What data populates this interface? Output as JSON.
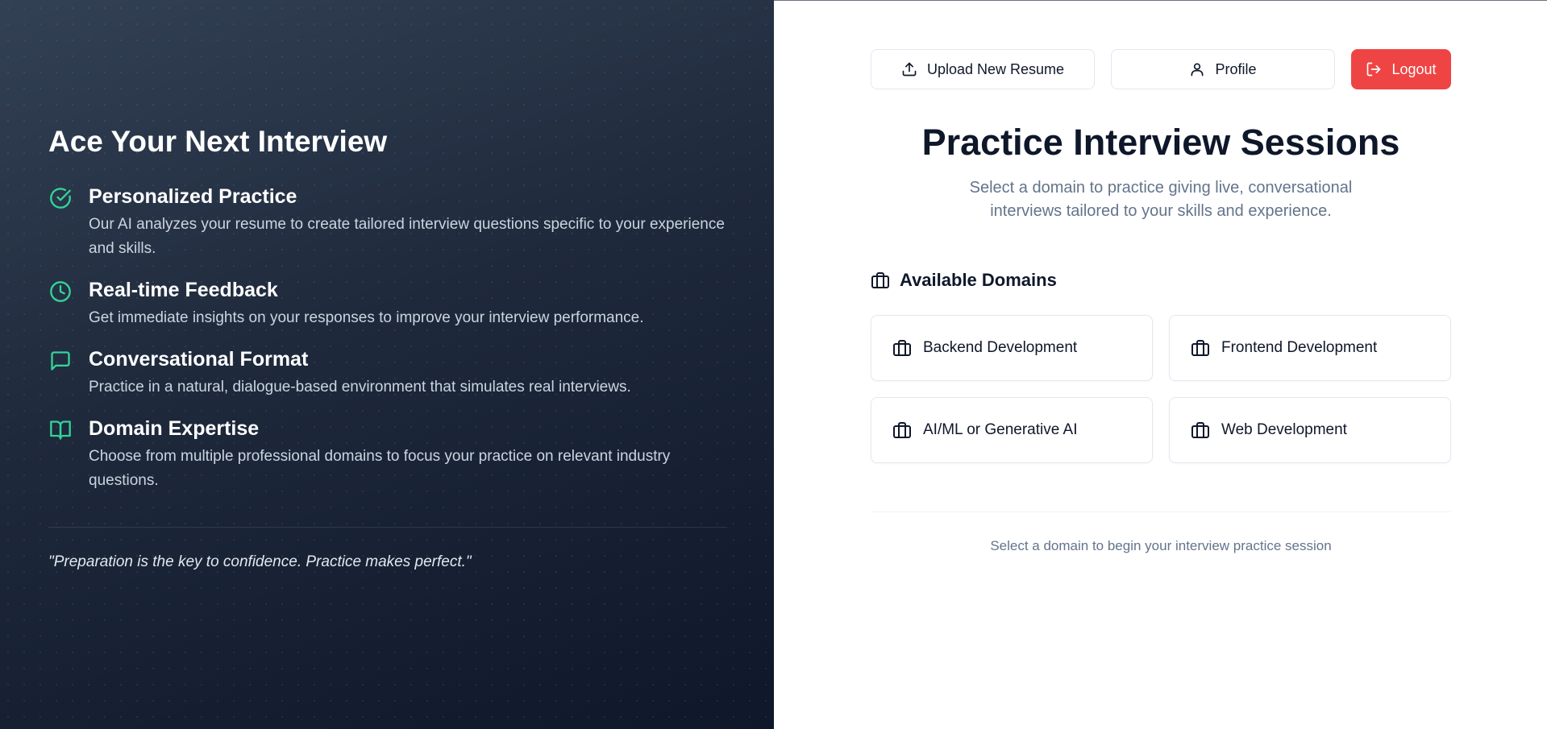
{
  "left_panel": {
    "title": "Ace Your Next Interview",
    "features": [
      {
        "icon": "check-circle-icon",
        "title": "Personalized Practice",
        "description": "Our AI analyzes your resume to create tailored interview questions specific to your experience and skills."
      },
      {
        "icon": "clock-icon",
        "title": "Real-time Feedback",
        "description": "Get immediate insights on your responses to improve your interview performance."
      },
      {
        "icon": "message-square-icon",
        "title": "Conversational Format",
        "description": "Practice in a natural, dialogue-based environment that simulates real interviews."
      },
      {
        "icon": "book-open-icon",
        "title": "Domain Expertise",
        "description": "Choose from multiple professional domains to focus your practice on relevant industry questions."
      }
    ],
    "quote": "\"Preparation is the key to confidence. Practice makes perfect.\"",
    "accent_color": "#34d399"
  },
  "toolbar": {
    "upload_label": "Upload New Resume",
    "profile_label": "Profile",
    "logout_label": "Logout",
    "logout_color": "#ef4444"
  },
  "main": {
    "title": "Practice Interview Sessions",
    "subtitle": "Select a domain to practice giving live, conversational interviews tailored to your skills and experience.",
    "section_title": "Available Domains",
    "domains": [
      {
        "label": "Backend Development",
        "icon": "briefcase-icon"
      },
      {
        "label": "Frontend Development",
        "icon": "briefcase-icon"
      },
      {
        "label": "AI/ML or Generative AI",
        "icon": "briefcase-icon"
      },
      {
        "label": "Web Development",
        "icon": "briefcase-icon"
      }
    ],
    "hint": "Select a domain to begin your interview practice session"
  }
}
